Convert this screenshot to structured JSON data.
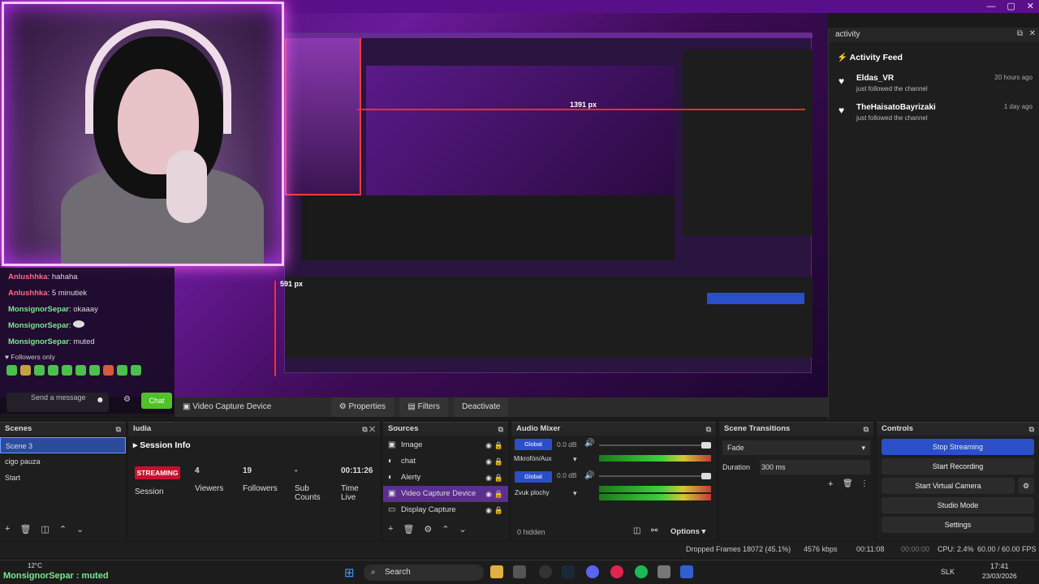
{
  "window": {
    "minimize": "—",
    "maximize": "▢",
    "close": "✕"
  },
  "preview": {
    "px_label_1": "1391 px",
    "px_label_2": "591 px"
  },
  "chat": {
    "lines": [
      {
        "user": "Anlushhka",
        "text": ": hahaha"
      },
      {
        "user": "Anlushhka",
        "text": ": 5 minutiek"
      },
      {
        "user": "MonsignorSepar",
        "text": ": okaaay"
      },
      {
        "user": "MonsignorSepar",
        "text": ":"
      },
      {
        "user": "MonsignorSepar",
        "text": ": muted"
      }
    ],
    "followers_only": "Followers only",
    "send_placeholder": "Send a message",
    "chat_button": "Chat"
  },
  "activity": {
    "panel_title": "activity",
    "feed_title": "Activity Feed",
    "items": [
      {
        "name": "Eldas_VR",
        "text": "just followed the channel",
        "time": "20 hours ago"
      },
      {
        "name": "TheHaisatoBayrizaki",
        "text": "just followed the channel",
        "time": "1 day ago"
      }
    ]
  },
  "toolbar": {
    "device": "Video Capture Device",
    "properties": "Properties",
    "filters": "Filters",
    "deactivate": "Deactivate"
  },
  "scenes": {
    "title": "Scenes",
    "items": [
      "Scene 3",
      "cigo pauza",
      "Start"
    ]
  },
  "ludia": {
    "title": "ludia",
    "session_info": "Session Info",
    "streaming": "STREAMING",
    "session": "Session",
    "viewers_val": "4",
    "viewers": "Viewers",
    "followers_val": "19",
    "followers": "Followers",
    "subs_val": "-",
    "subs": "Sub Counts",
    "time_val": "00:11:26",
    "time": "Time Live"
  },
  "sources": {
    "title": "Sources",
    "items": [
      "Image",
      "chat",
      "Alerty",
      "Video Capture Device",
      "Display Capture"
    ]
  },
  "audio": {
    "title": "Audio Mixer",
    "global": "Global",
    "db1": "0.0 dB",
    "mic": "Mikrofón/Aux",
    "db2": "0.0 dB",
    "desktop": "Zvuk plochy",
    "hidden": "0 hidden",
    "options": "Options"
  },
  "transitions": {
    "title": "Scene Transitions",
    "type": "Fade",
    "duration_label": "Duration",
    "duration_val": "300 ms"
  },
  "controls": {
    "title": "Controls",
    "stop_streaming": "Stop Streaming",
    "start_recording": "Start Recording",
    "start_virtual_camera": "Start Virtual Camera",
    "studio_mode": "Studio Mode",
    "settings": "Settings"
  },
  "status": {
    "dropped": "Dropped Frames 18072 (45.1%)",
    "kbps": "4576 kbps",
    "live_time": "00:11:08",
    "rec_time": "00:00:00",
    "cpu": "CPU: 2.4%",
    "fps": "60.00 / 60.00 FPS"
  },
  "taskbar": {
    "weather": "12°C",
    "overlay": "MonsignorSepar : muted",
    "search": "Search",
    "lang": "SLK",
    "time": "17:41",
    "date": "23/03/2026"
  },
  "colors": {
    "accent": "#2b4fc8",
    "streaming_red": "#c8102e",
    "chat_green": "#53c02a"
  }
}
